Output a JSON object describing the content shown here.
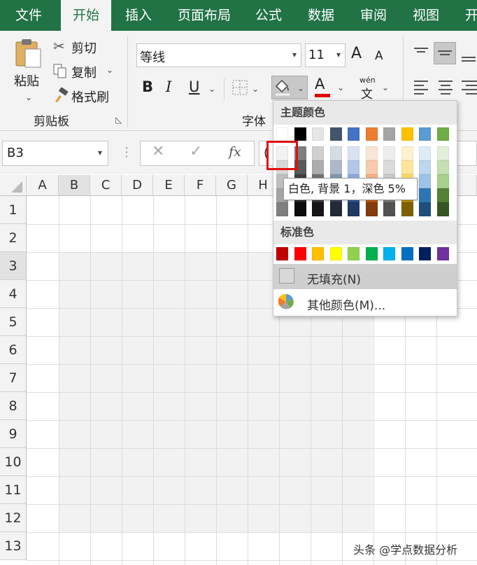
{
  "menu": {
    "tabs": [
      "文件",
      "开始",
      "插入",
      "页面布局",
      "公式",
      "数据",
      "审阅",
      "视图",
      "开"
    ]
  },
  "clipboard": {
    "paste": "粘贴",
    "cut": "剪切",
    "copy": "复制",
    "format_painter": "格式刷",
    "group_label": "剪贴板"
  },
  "font": {
    "name": "等线",
    "size": "11",
    "group_label": "字体",
    "bold": "B",
    "italic": "I",
    "underline": "U",
    "font_color_letter": "A",
    "phonetic_top": "wén",
    "phonetic_bottom": "文",
    "grow": "A",
    "shrink": "A"
  },
  "formula_bar": {
    "name_box": "B3",
    "fx": "fx",
    "formula_value": "("
  },
  "grid": {
    "columns": [
      "A",
      "B",
      "C",
      "D",
      "E",
      "F",
      "G",
      "H"
    ],
    "rows": [
      "1",
      "2",
      "3",
      "4",
      "5",
      "6",
      "7",
      "8",
      "9",
      "10",
      "11",
      "12",
      "13"
    ]
  },
  "palette": {
    "theme_title": "主题颜色",
    "standard_title": "标准色",
    "no_fill": "无填充(N)",
    "more_colors": "其他颜色(M)...",
    "tooltip": "白色, 背景 1，深色 5%",
    "theme_base": [
      "#ffffff",
      "#000000",
      "#e7e6e6",
      "#44546a",
      "#4472c4",
      "#ed7d31",
      "#a5a5a5",
      "#ffc000",
      "#5b9bd5",
      "#70ad47"
    ],
    "theme_shades": [
      [
        "#f2f2f2",
        "#7f7f7f",
        "#d0cece",
        "#d6dce4",
        "#d9e2f3",
        "#fbe5d5",
        "#ededed",
        "#fff2cc",
        "#deebf6",
        "#e2efd9"
      ],
      [
        "#d8d8d8",
        "#595959",
        "#aeabab",
        "#adb9ca",
        "#b4c6e7",
        "#f7cbac",
        "#dbdbdb",
        "#fee599",
        "#bdd7ee",
        "#c5e0b3"
      ],
      [
        "#bfbfbf",
        "#3f3f3f",
        "#757070",
        "#8496b0",
        "#8eaadb",
        "#f4b183",
        "#c9c9c9",
        "#ffd965",
        "#9dc3e6",
        "#a8d08d"
      ],
      [
        "#a5a5a5",
        "#262626",
        "#3a3838",
        "#323f4f",
        "#2f5496",
        "#c55a11",
        "#7b7b7b",
        "#bf8f00",
        "#2e75b5",
        "#538135"
      ],
      [
        "#7f7f7f",
        "#0c0c0c",
        "#171616",
        "#222a35",
        "#1f3864",
        "#833c0b",
        "#525252",
        "#7f6000",
        "#1e4e79",
        "#375623"
      ]
    ],
    "standard": [
      "#c00000",
      "#ff0000",
      "#ffc000",
      "#ffff00",
      "#92d050",
      "#00b050",
      "#00b0f0",
      "#0070c0",
      "#002060",
      "#7030a0"
    ],
    "highlight_color": "#e01010"
  },
  "watermark": "头条 @学点数据分析"
}
